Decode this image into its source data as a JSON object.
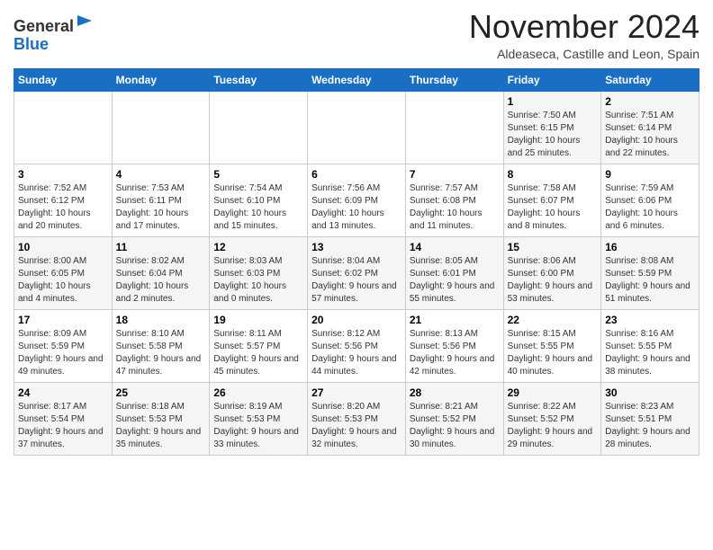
{
  "header": {
    "logo_line1": "General",
    "logo_line2": "Blue",
    "month": "November 2024",
    "location": "Aldeaseca, Castille and Leon, Spain"
  },
  "columns": [
    "Sunday",
    "Monday",
    "Tuesday",
    "Wednesday",
    "Thursday",
    "Friday",
    "Saturday"
  ],
  "weeks": [
    [
      {
        "day": "",
        "info": ""
      },
      {
        "day": "",
        "info": ""
      },
      {
        "day": "",
        "info": ""
      },
      {
        "day": "",
        "info": ""
      },
      {
        "day": "",
        "info": ""
      },
      {
        "day": "1",
        "info": "Sunrise: 7:50 AM\nSunset: 6:15 PM\nDaylight: 10 hours and 25 minutes."
      },
      {
        "day": "2",
        "info": "Sunrise: 7:51 AM\nSunset: 6:14 PM\nDaylight: 10 hours and 22 minutes."
      }
    ],
    [
      {
        "day": "3",
        "info": "Sunrise: 7:52 AM\nSunset: 6:12 PM\nDaylight: 10 hours and 20 minutes."
      },
      {
        "day": "4",
        "info": "Sunrise: 7:53 AM\nSunset: 6:11 PM\nDaylight: 10 hours and 17 minutes."
      },
      {
        "day": "5",
        "info": "Sunrise: 7:54 AM\nSunset: 6:10 PM\nDaylight: 10 hours and 15 minutes."
      },
      {
        "day": "6",
        "info": "Sunrise: 7:56 AM\nSunset: 6:09 PM\nDaylight: 10 hours and 13 minutes."
      },
      {
        "day": "7",
        "info": "Sunrise: 7:57 AM\nSunset: 6:08 PM\nDaylight: 10 hours and 11 minutes."
      },
      {
        "day": "8",
        "info": "Sunrise: 7:58 AM\nSunset: 6:07 PM\nDaylight: 10 hours and 8 minutes."
      },
      {
        "day": "9",
        "info": "Sunrise: 7:59 AM\nSunset: 6:06 PM\nDaylight: 10 hours and 6 minutes."
      }
    ],
    [
      {
        "day": "10",
        "info": "Sunrise: 8:00 AM\nSunset: 6:05 PM\nDaylight: 10 hours and 4 minutes."
      },
      {
        "day": "11",
        "info": "Sunrise: 8:02 AM\nSunset: 6:04 PM\nDaylight: 10 hours and 2 minutes."
      },
      {
        "day": "12",
        "info": "Sunrise: 8:03 AM\nSunset: 6:03 PM\nDaylight: 10 hours and 0 minutes."
      },
      {
        "day": "13",
        "info": "Sunrise: 8:04 AM\nSunset: 6:02 PM\nDaylight: 9 hours and 57 minutes."
      },
      {
        "day": "14",
        "info": "Sunrise: 8:05 AM\nSunset: 6:01 PM\nDaylight: 9 hours and 55 minutes."
      },
      {
        "day": "15",
        "info": "Sunrise: 8:06 AM\nSunset: 6:00 PM\nDaylight: 9 hours and 53 minutes."
      },
      {
        "day": "16",
        "info": "Sunrise: 8:08 AM\nSunset: 5:59 PM\nDaylight: 9 hours and 51 minutes."
      }
    ],
    [
      {
        "day": "17",
        "info": "Sunrise: 8:09 AM\nSunset: 5:59 PM\nDaylight: 9 hours and 49 minutes."
      },
      {
        "day": "18",
        "info": "Sunrise: 8:10 AM\nSunset: 5:58 PM\nDaylight: 9 hours and 47 minutes."
      },
      {
        "day": "19",
        "info": "Sunrise: 8:11 AM\nSunset: 5:57 PM\nDaylight: 9 hours and 45 minutes."
      },
      {
        "day": "20",
        "info": "Sunrise: 8:12 AM\nSunset: 5:56 PM\nDaylight: 9 hours and 44 minutes."
      },
      {
        "day": "21",
        "info": "Sunrise: 8:13 AM\nSunset: 5:56 PM\nDaylight: 9 hours and 42 minutes."
      },
      {
        "day": "22",
        "info": "Sunrise: 8:15 AM\nSunset: 5:55 PM\nDaylight: 9 hours and 40 minutes."
      },
      {
        "day": "23",
        "info": "Sunrise: 8:16 AM\nSunset: 5:55 PM\nDaylight: 9 hours and 38 minutes."
      }
    ],
    [
      {
        "day": "24",
        "info": "Sunrise: 8:17 AM\nSunset: 5:54 PM\nDaylight: 9 hours and 37 minutes."
      },
      {
        "day": "25",
        "info": "Sunrise: 8:18 AM\nSunset: 5:53 PM\nDaylight: 9 hours and 35 minutes."
      },
      {
        "day": "26",
        "info": "Sunrise: 8:19 AM\nSunset: 5:53 PM\nDaylight: 9 hours and 33 minutes."
      },
      {
        "day": "27",
        "info": "Sunrise: 8:20 AM\nSunset: 5:53 PM\nDaylight: 9 hours and 32 minutes."
      },
      {
        "day": "28",
        "info": "Sunrise: 8:21 AM\nSunset: 5:52 PM\nDaylight: 9 hours and 30 minutes."
      },
      {
        "day": "29",
        "info": "Sunrise: 8:22 AM\nSunset: 5:52 PM\nDaylight: 9 hours and 29 minutes."
      },
      {
        "day": "30",
        "info": "Sunrise: 8:23 AM\nSunset: 5:51 PM\nDaylight: 9 hours and 28 minutes."
      }
    ]
  ]
}
